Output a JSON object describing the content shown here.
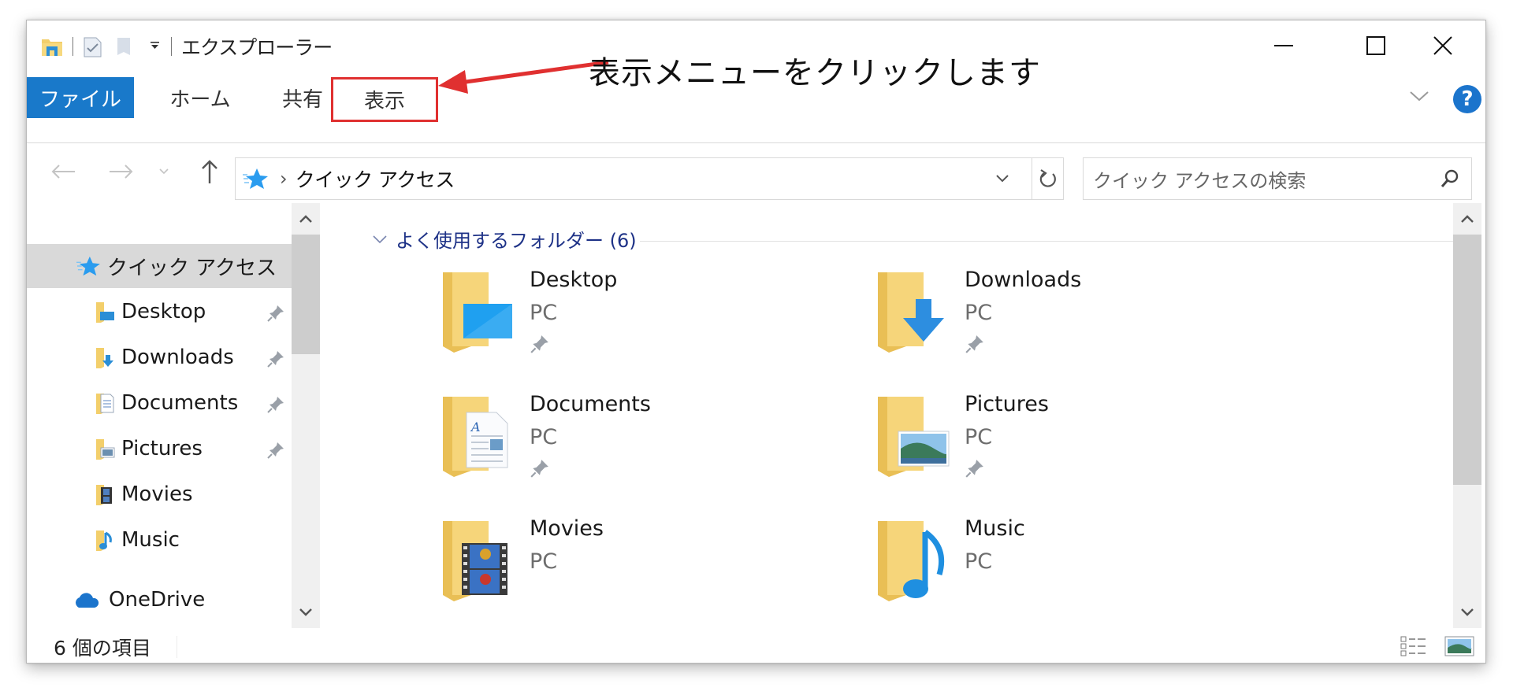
{
  "window": {
    "title": "エクスプローラー",
    "controls": {
      "minimize": "minimize",
      "maximize": "maximize",
      "close": "close"
    }
  },
  "ribbon": {
    "tabs": [
      {
        "label": "ファイル",
        "active": true
      },
      {
        "label": "ホーム"
      },
      {
        "label": "共有"
      },
      {
        "label": "表示",
        "highlighted": true
      }
    ],
    "help_label": "?"
  },
  "annotation": {
    "text": "表示メニューをクリックします",
    "color": "#e03030"
  },
  "address_bar": {
    "path": [
      "クイック アクセス"
    ],
    "separator": "›"
  },
  "search": {
    "placeholder": "クイック アクセスの検索"
  },
  "nav_pane": {
    "items": [
      {
        "label": "クイック アクセス",
        "icon": "star-icon",
        "selected": true,
        "level": 0
      },
      {
        "label": "Desktop",
        "icon": "desktop-folder-icon",
        "pinned": true,
        "level": 1
      },
      {
        "label": "Downloads",
        "icon": "downloads-folder-icon",
        "pinned": true,
        "level": 1
      },
      {
        "label": "Documents",
        "icon": "documents-folder-icon",
        "pinned": true,
        "level": 1
      },
      {
        "label": "Pictures",
        "icon": "pictures-folder-icon",
        "pinned": true,
        "level": 1
      },
      {
        "label": "Movies",
        "icon": "movies-folder-icon",
        "pinned": false,
        "level": 1
      },
      {
        "label": "Music",
        "icon": "music-folder-icon",
        "pinned": false,
        "level": 1
      },
      {
        "label": "OneDrive",
        "icon": "onedrive-icon",
        "level": 0
      }
    ]
  },
  "content": {
    "group_title": "よく使用するフォルダー (6)",
    "folders": [
      {
        "name": "Desktop",
        "location": "PC",
        "pinned": true
      },
      {
        "name": "Downloads",
        "location": "PC",
        "pinned": true
      },
      {
        "name": "Documents",
        "location": "PC",
        "pinned": true
      },
      {
        "name": "Pictures",
        "location": "PC",
        "pinned": true
      },
      {
        "name": "Movies",
        "location": "PC",
        "pinned": false
      },
      {
        "name": "Music",
        "location": "PC",
        "pinned": false
      }
    ]
  },
  "status_bar": {
    "item_count": "6 個の項目"
  },
  "colors": {
    "accent": "#1979ca",
    "folder": "#f3cf6b",
    "selected_bg": "#d9d9d9",
    "group_title": "#1e3287"
  }
}
